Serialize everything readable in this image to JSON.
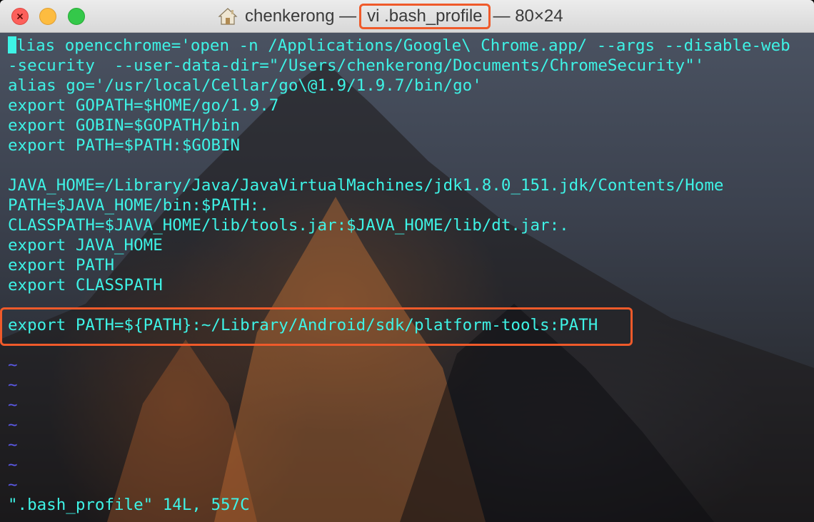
{
  "window": {
    "title_prefix": "chenkerong —",
    "title_highlight": "vi .bash_profile",
    "title_suffix": "— 80×24"
  },
  "editor": {
    "lines": [
      "lias opencchrome='open -n /Applications/Google\\ Chrome.app/ --args --disable-web",
      "-security  --user-data-dir=\"/Users/chenkerong/Documents/ChromeSecurity\"'",
      "alias go='/usr/local/Cellar/go\\@1.9/1.9.7/bin/go'",
      "export GOPATH=$HOME/go/1.9.7",
      "export GOBIN=$GOPATH/bin",
      "export PATH=$PATH:$GOBIN",
      "",
      "JAVA_HOME=/Library/Java/JavaVirtualMachines/jdk1.8.0_151.jdk/Contents/Home",
      "PATH=$JAVA_HOME/bin:$PATH:.",
      "CLASSPATH=$JAVA_HOME/lib/tools.jar:$JAVA_HOME/lib/dt.jar:.",
      "export JAVA_HOME",
      "export PATH",
      "export CLASSPATH",
      "",
      "export PATH=${PATH}:~/Library/Android/sdk/platform-tools:PATH",
      "",
      "~",
      "~",
      "~",
      "~",
      "~",
      "~",
      "~",
      "\".bash_profile\" 14L, 557C"
    ],
    "highlighted_line_index": 14
  },
  "colors": {
    "text": "#3ef3e6",
    "tilde": "#5a59e6",
    "highlight": "#ef5a2a"
  }
}
